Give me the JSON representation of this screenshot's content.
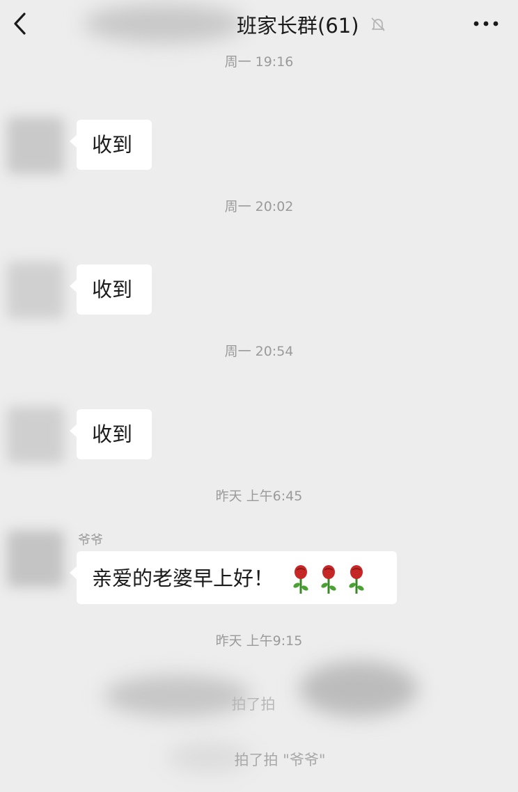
{
  "header": {
    "back_icon": "chevron-left-icon",
    "title": "班家长群(61)",
    "mute_icon": "bell-off-icon",
    "more_icon": "ellipsis-icon"
  },
  "messages": [
    {
      "timestamp": "周一 19:16",
      "text": "收到"
    },
    {
      "timestamp": "周一 20:02",
      "text": "收到"
    },
    {
      "timestamp": "周一 20:54",
      "text": "收到"
    },
    {
      "timestamp": "昨天 上午6:45",
      "sender": "爷爷",
      "text": "亲爱的老婆早上好！",
      "emoji": "rose",
      "emoji_count": 3
    }
  ],
  "footer": {
    "timestamp": "昨天 上午9:15",
    "system_note_1": "拍了拍",
    "system_note_2": "拍了拍 \"爷爷\""
  },
  "colors": {
    "background": "#ededed",
    "bubble": "#ffffff",
    "text": "#1a1a1a",
    "muted_text": "#9a9a9a"
  }
}
